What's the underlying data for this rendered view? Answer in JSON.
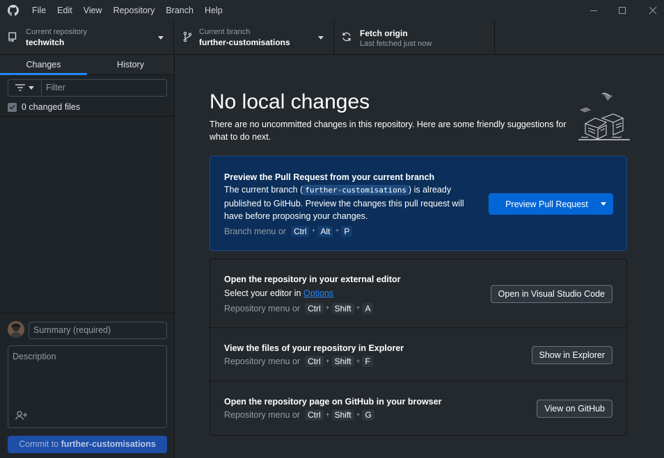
{
  "window": {
    "menu": [
      "File",
      "Edit",
      "View",
      "Repository",
      "Branch",
      "Help"
    ],
    "controls": {
      "minimize": "minimize-icon",
      "maximize": "maximize-icon",
      "close": "close-icon"
    }
  },
  "toolbar": {
    "repository": {
      "desc": "Current repository",
      "title": "techwitch"
    },
    "branch": {
      "desc": "Current branch",
      "title": "further-customisations"
    },
    "fetch": {
      "title": "Fetch origin",
      "desc": "Last fetched just now"
    }
  },
  "sidebar": {
    "tabs": [
      "Changes",
      "History"
    ],
    "filter_placeholder": "Filter",
    "changed_files": "0 changed files",
    "summary_placeholder": "Summary (required)",
    "description_placeholder": "Description",
    "commit_prefix": "Commit to",
    "commit_branch": "further-customisations"
  },
  "main": {
    "heading": "No local changes",
    "subheading": "There are no uncommitted changes in this repository. Here are some friendly suggestions for what to do next.",
    "pull_request": {
      "title": "Preview the Pull Request from your current branch",
      "text_before": "The current branch (",
      "branch": "further-customisations",
      "text_after": ") is already published to GitHub. Preview the changes this pull request will have before proposing your changes.",
      "shortcut_prefix": "Branch menu or",
      "keys": [
        "Ctrl",
        "Alt",
        "P"
      ],
      "button": "Preview Pull Request"
    },
    "editor": {
      "title": "Open the repository in your external editor",
      "text_prefix": "Select your editor in",
      "link": "Options",
      "shortcut_prefix": "Repository menu or",
      "keys": [
        "Ctrl",
        "Shift",
        "A"
      ],
      "button": "Open in Visual Studio Code"
    },
    "explorer": {
      "title": "View the files of your repository in Explorer",
      "shortcut_prefix": "Repository menu or",
      "keys": [
        "Ctrl",
        "Shift",
        "F"
      ],
      "button": "Show in Explorer"
    },
    "github": {
      "title": "Open the repository page on GitHub in your browser",
      "shortcut_prefix": "Repository menu or",
      "keys": [
        "Ctrl",
        "Shift",
        "G"
      ],
      "button": "View on GitHub"
    }
  },
  "colors": {
    "accent": "#0366d6",
    "background": "#24292e",
    "sidebar": "#1f2428",
    "primary_card": "#0b2f5a"
  }
}
